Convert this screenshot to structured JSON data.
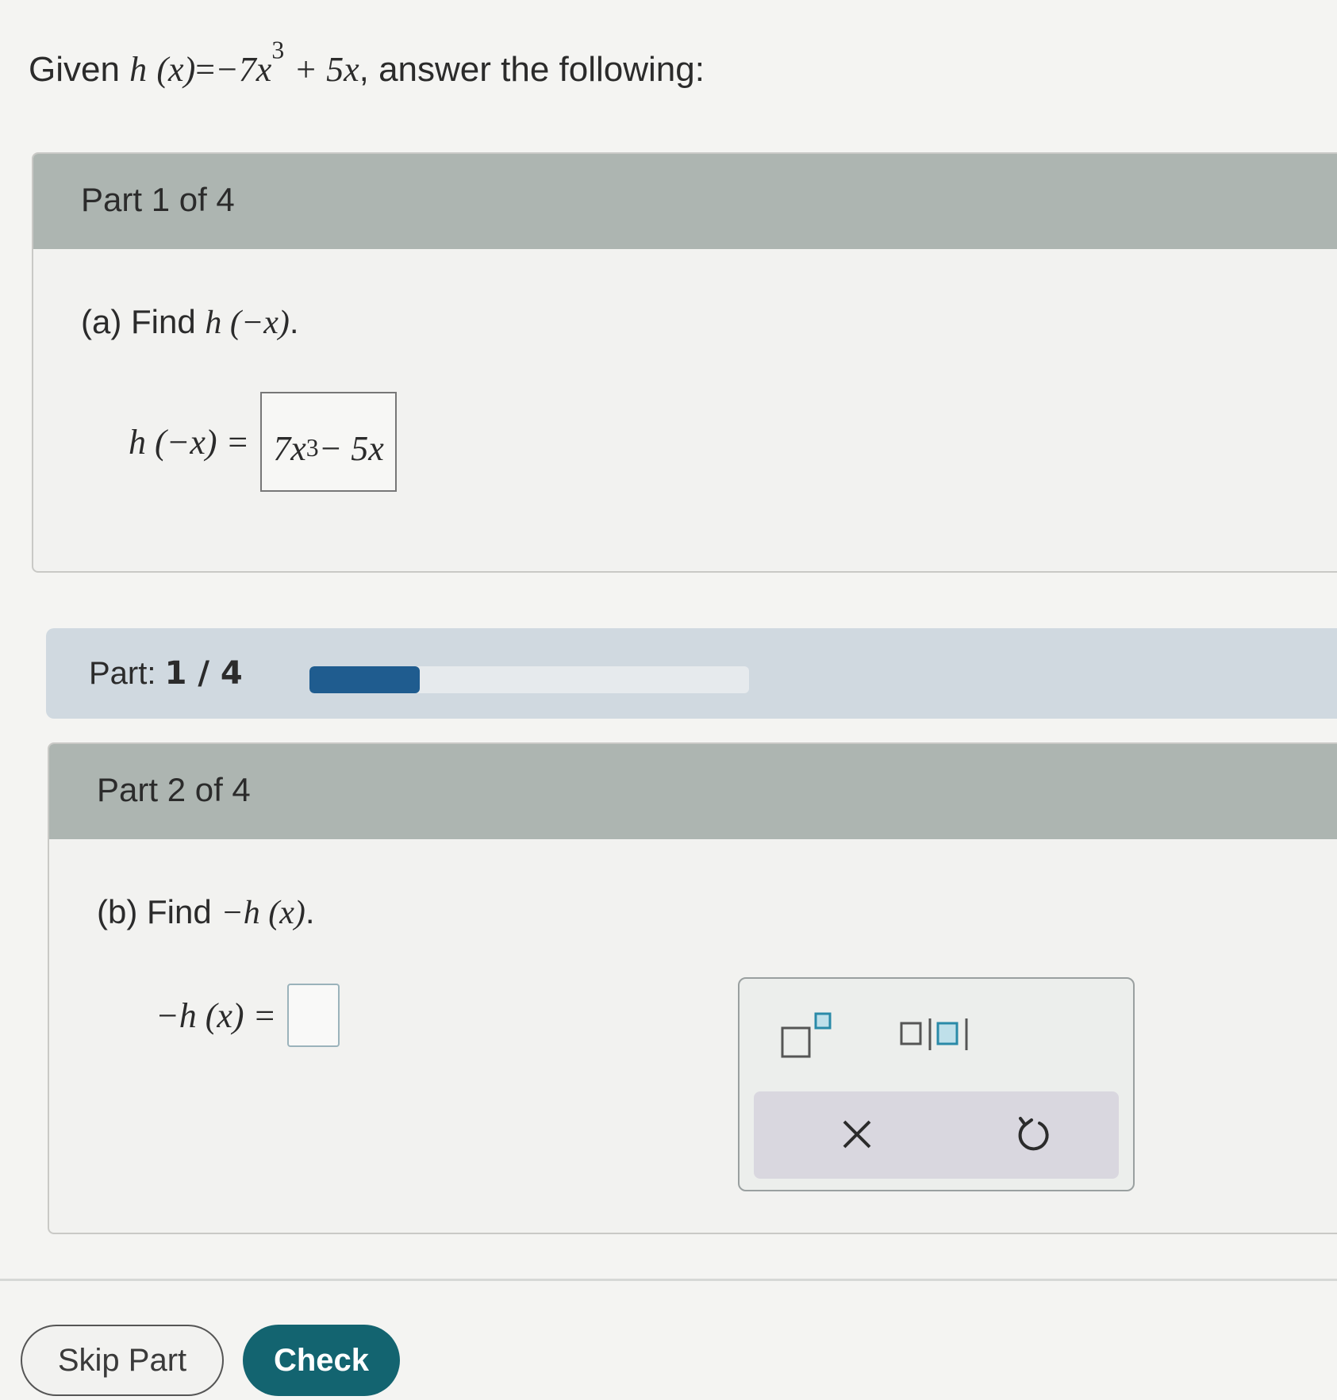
{
  "problem": {
    "prefix": "Given ",
    "func_name": "h",
    "func_arg": "(x)",
    "equals": "=",
    "term1": "−7x",
    "term1_exp": "3",
    "term2": "+ 5x",
    "suffix": ", answer the following:"
  },
  "part1": {
    "header": "Part 1 of 4",
    "question_prefix": "(a) Find ",
    "question_expr": "h (−x)",
    "question_suffix": ".",
    "answer_lhs": "h (−x) =",
    "answer_term1": "7x",
    "answer_term1_exp": "3",
    "answer_term2": " − 5x"
  },
  "progress": {
    "label": "Part:",
    "value": "1 / 4",
    "fraction": 0.25,
    "fill_color": "#1f5c8f"
  },
  "part2": {
    "header": "Part 2 of 4",
    "question_prefix": "(b) Find ",
    "question_expr": "−h (x)",
    "question_suffix": ".",
    "answer_lhs": "−h (x) =",
    "answer_value": ""
  },
  "palette": {
    "buttons": [
      {
        "name": "exponent-icon"
      },
      {
        "name": "absolute-value-icon"
      },
      {
        "name": "clear-icon"
      },
      {
        "name": "undo-icon"
      }
    ]
  },
  "actions": {
    "skip_label": "Skip Part",
    "check_label": "Check"
  },
  "colors": {
    "accent": "#136470",
    "palette_icon": "#2a8aa8"
  }
}
